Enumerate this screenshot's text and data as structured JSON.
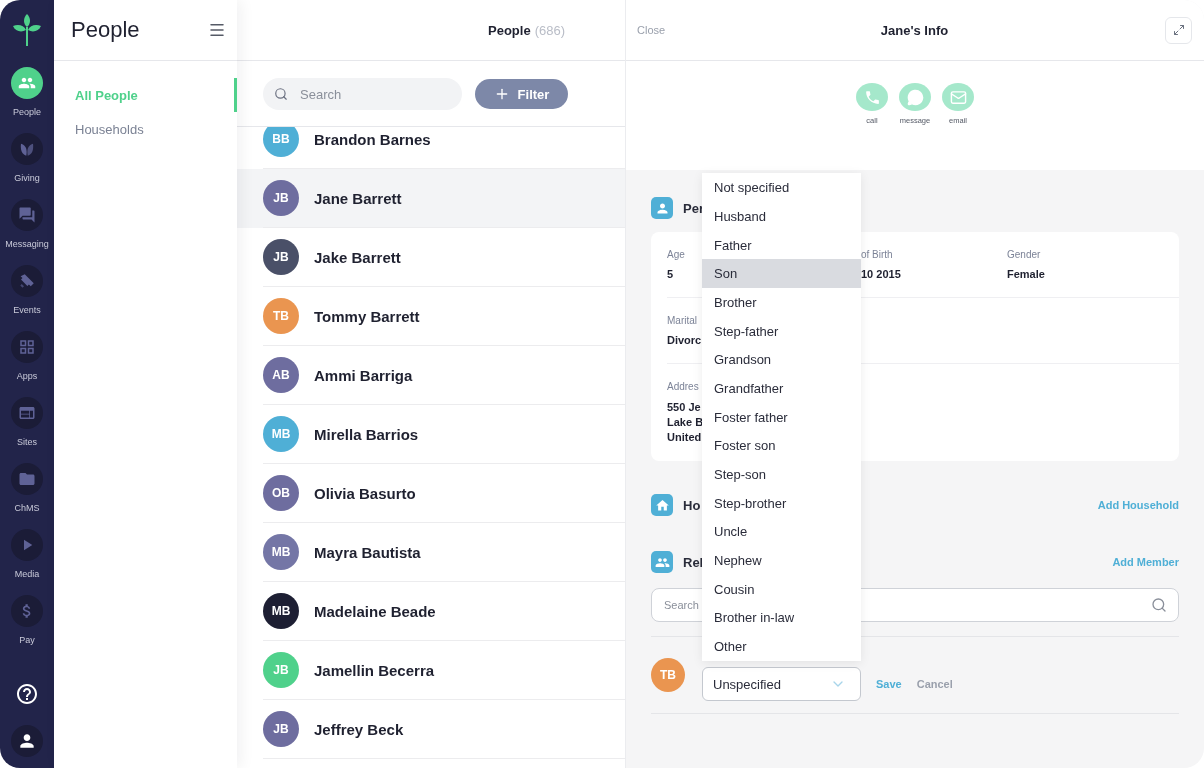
{
  "nav_rail": {
    "items": [
      {
        "label": "People",
        "selected": true
      },
      {
        "label": "Giving",
        "selected": false
      },
      {
        "label": "Messaging",
        "selected": false
      },
      {
        "label": "Events",
        "selected": false
      },
      {
        "label": "Apps",
        "selected": false
      },
      {
        "label": "Sites",
        "selected": false
      },
      {
        "label": "ChMS",
        "selected": false
      },
      {
        "label": "Media",
        "selected": false
      },
      {
        "label": "Pay",
        "selected": false
      }
    ]
  },
  "sidebar": {
    "title": "People",
    "items": [
      {
        "label": "All People",
        "selected": true
      },
      {
        "label": "Households",
        "selected": false
      }
    ]
  },
  "people_list": {
    "title": "People",
    "count": "(686)",
    "search": {
      "placeholder": "Search"
    },
    "filter_button": "Filter",
    "rows": [
      {
        "initials": "BB",
        "name": "Brandon Barnes",
        "color": "#4fafd6",
        "selected": false
      },
      {
        "initials": "JB",
        "name": "Jane Barrett",
        "color": "#6e6d9f",
        "selected": true
      },
      {
        "initials": "JB",
        "name": "Jake Barrett",
        "color": "#4a5068",
        "selected": false
      },
      {
        "initials": "TB",
        "name": "Tommy Barrett",
        "color": "#ea9550",
        "selected": false
      },
      {
        "initials": "AB",
        "name": "Ammi Barriga",
        "color": "#6e6d9f",
        "selected": false
      },
      {
        "initials": "MB",
        "name": "Mirella Barrios",
        "color": "#4fafd6",
        "selected": false
      },
      {
        "initials": "OB",
        "name": "Olivia Basurto",
        "color": "#6e6d9f",
        "selected": false
      },
      {
        "initials": "MB",
        "name": "Mayra Bautista",
        "color": "#7476a6",
        "selected": false
      },
      {
        "initials": "MB",
        "name": "Madelaine Beade",
        "color": "#1d1f33",
        "selected": false
      },
      {
        "initials": "JB",
        "name": "Jamellin Becerra",
        "color": "#4fd18b",
        "selected": false
      },
      {
        "initials": "JB",
        "name": "Jeffrey Beck",
        "color": "#6e6d9f",
        "selected": false
      }
    ]
  },
  "detail": {
    "close": "Close",
    "title": "Jane's Info",
    "actions": [
      {
        "label": "call"
      },
      {
        "label": "message"
      },
      {
        "label": "email"
      }
    ],
    "personal": {
      "title": "Per",
      "rows": [
        {
          "fields": [
            {
              "label": "Age",
              "value": "5"
            },
            {
              "label": "of Birth",
              "value": "10 2015"
            },
            {
              "label": "Gender",
              "value": "Female"
            }
          ]
        },
        {
          "fields": [
            {
              "label": "Marital",
              "value": "Divorc"
            }
          ]
        },
        {
          "fields": [
            {
              "label": "Addres",
              "lines": [
                "550 Je",
                "Lake B",
                "United"
              ]
            }
          ]
        }
      ]
    },
    "households": {
      "title": "Ho",
      "link": "Add Household"
    },
    "relationships": {
      "title": "Rel",
      "link": "Add Member",
      "search": {
        "placeholder": "Search"
      },
      "member": {
        "initials": "TB",
        "color": "#ea9550",
        "relation": {
          "value": "Unspecified",
          "expanded": true,
          "options": [
            {
              "label": "Not specified",
              "selected": false
            },
            {
              "label": "Husband",
              "selected": false
            },
            {
              "label": "Father",
              "selected": false
            },
            {
              "label": "Son",
              "selected": true
            },
            {
              "label": "Brother",
              "selected": false
            },
            {
              "label": "Step-father",
              "selected": false
            },
            {
              "label": "Grandson",
              "selected": false
            },
            {
              "label": "Grandfather",
              "selected": false
            },
            {
              "label": "Foster father",
              "selected": false
            },
            {
              "label": "Foster son",
              "selected": false
            },
            {
              "label": "Step-son",
              "selected": false
            },
            {
              "label": "Step-brother",
              "selected": false
            },
            {
              "label": "Uncle",
              "selected": false
            },
            {
              "label": "Nephew",
              "selected": false
            },
            {
              "label": "Cousin",
              "selected": false
            },
            {
              "label": "Brother in-law",
              "selected": false
            },
            {
              "label": "Other",
              "selected": false
            }
          ]
        }
      },
      "save": "Save",
      "cancel": "Cancel"
    }
  }
}
